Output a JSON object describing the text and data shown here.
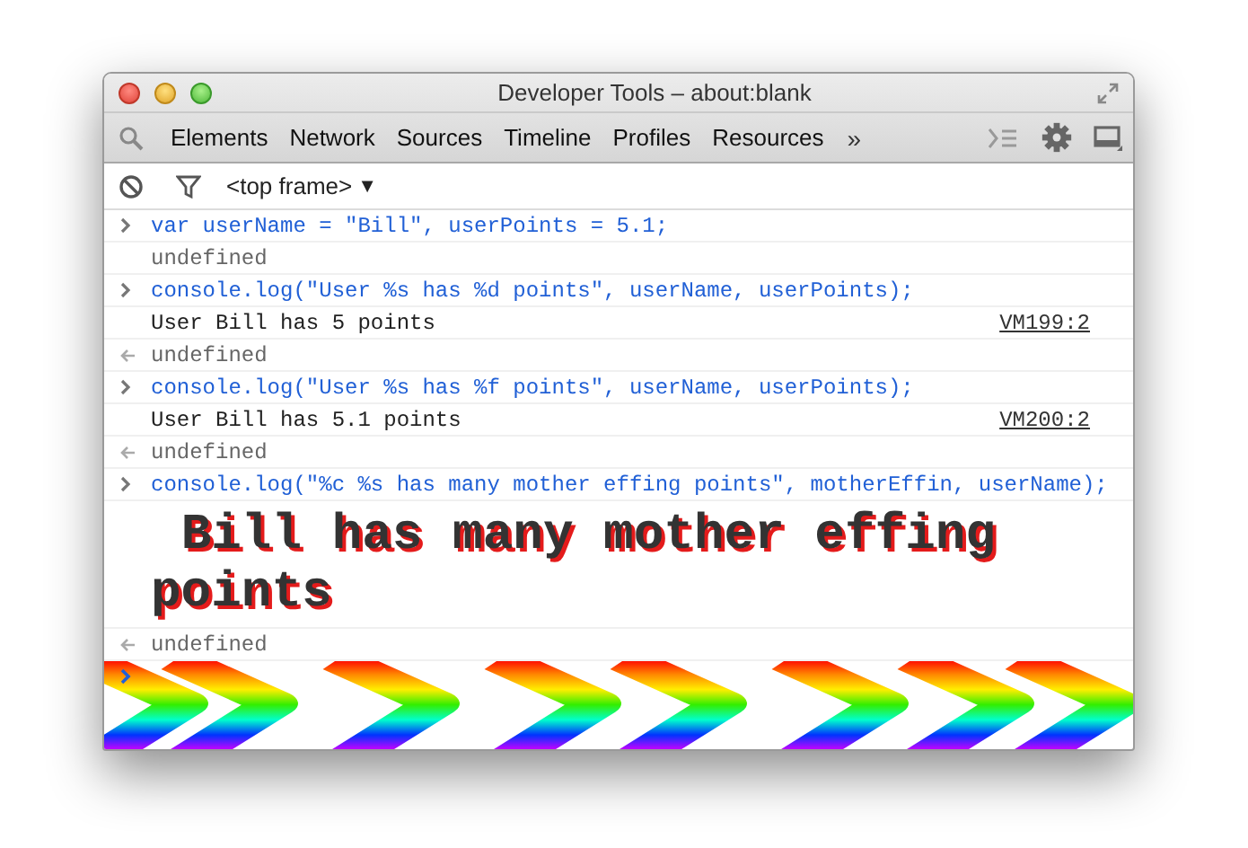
{
  "window": {
    "title": "Developer Tools – about:blank"
  },
  "toolbar": {
    "tabs": [
      {
        "label": "Elements",
        "selected": false
      },
      {
        "label": "Network",
        "selected": false
      },
      {
        "label": "Sources",
        "selected": false
      },
      {
        "label": "Timeline",
        "selected": false
      },
      {
        "label": "Profiles",
        "selected": false
      },
      {
        "label": "Resources",
        "selected": false
      }
    ],
    "overflow": "»"
  },
  "console_toolbar": {
    "frame_selector": "<top frame>",
    "dropdown_arrow": "▼"
  },
  "console": {
    "entries": [
      {
        "kind": "input",
        "text": "var userName = \"Bill\", userPoints = 5.1;"
      },
      {
        "kind": "result",
        "text": "undefined"
      },
      {
        "kind": "input",
        "text": "console.log(\"User %s has %d points\", userName, userPoints);"
      },
      {
        "kind": "log",
        "text": "User Bill has 5 points",
        "source": "VM199:2"
      },
      {
        "kind": "return",
        "text": "undefined"
      },
      {
        "kind": "input",
        "text": "console.log(\"User %s has %f points\", userName, userPoints);"
      },
      {
        "kind": "log",
        "text": "User Bill has 5.1 points",
        "source": "VM200:2"
      },
      {
        "kind": "return",
        "text": "undefined"
      },
      {
        "kind": "input",
        "text": "console.log(\"%c %s has many mother effing points\", motherEffin, userName);"
      },
      {
        "kind": "styled_log",
        "text": " Bill has many mother effing points"
      },
      {
        "kind": "return",
        "text": "undefined"
      }
    ]
  }
}
